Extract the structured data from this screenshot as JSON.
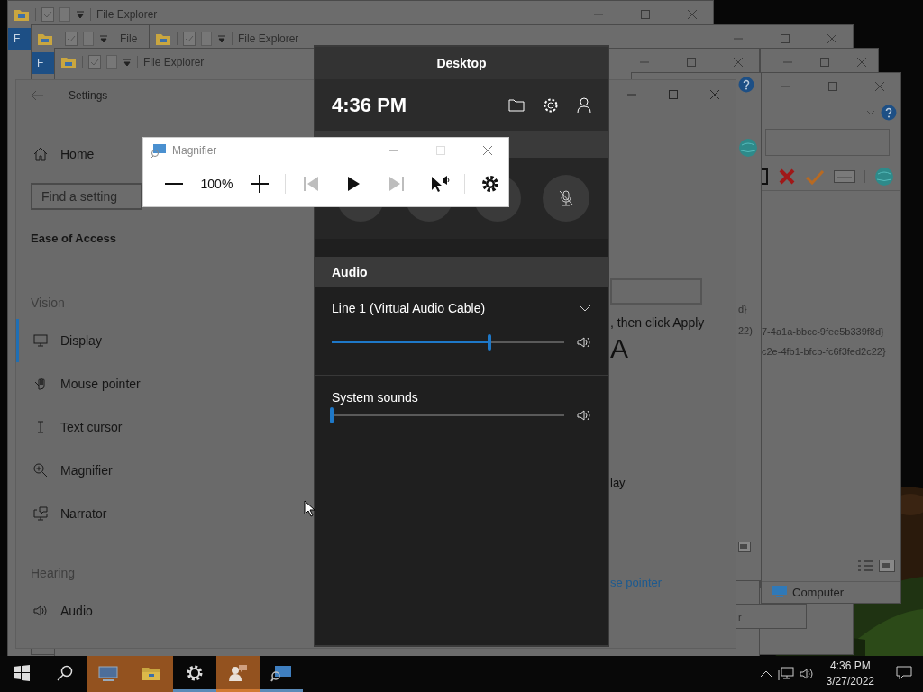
{
  "explorer_windows": [
    {
      "title": "File Explorer",
      "ribbon_tab": "F"
    },
    {
      "title": "File",
      "ribbon_tab": "F"
    },
    {
      "title": "File Explorer"
    },
    {
      "title": "File Explorer"
    }
  ],
  "dialogs": [
    {
      "lines": [
        "d}",
        "22)"
      ]
    },
    {
      "lines": [
        "7-4a1a-bbcc-9fee5b339f8d}",
        "c2e-4fb1-bfcb-fc6f3fed2c22}"
      ],
      "status": "Computer"
    },
    {
      "lines": [
        "r"
      ]
    }
  ],
  "settings": {
    "title": "Settings",
    "home": "Home",
    "search": {
      "placeholder": "Find a setting"
    },
    "heading": "Ease of Access",
    "groups": [
      {
        "label": "Vision",
        "items": [
          {
            "kind": "display",
            "label": "Display",
            "selected": true
          },
          {
            "kind": "mouse",
            "label": "Mouse pointer",
            "selected": false
          },
          {
            "kind": "text-cursor",
            "label": "Text cursor",
            "selected": false
          },
          {
            "kind": "magnifier",
            "label": "Magnifier",
            "selected": false
          },
          {
            "kind": "narrator",
            "label": "Narrator",
            "selected": false
          }
        ]
      },
      {
        "label": "Hearing",
        "items": [
          {
            "kind": "audio",
            "label": "Audio",
            "selected": false
          }
        ]
      }
    ],
    "content": {
      "instruction": ", then click Apply",
      "sample": "A",
      "line_3": "lay",
      "link": "se pointer"
    }
  },
  "game_bar": {
    "title": "Desktop",
    "time": "4:36 PM",
    "audio": {
      "heading": "Audio",
      "devices": [
        {
          "name": "Line 1 (Virtual Audio Cable)",
          "level": 0.68,
          "expandable": true
        },
        {
          "name": "System sounds",
          "level": 0,
          "expandable": false
        }
      ]
    }
  },
  "magnifier": {
    "title": "Magnifier",
    "zoom": "100%",
    "controls": [
      {
        "kind": "previous",
        "disabled": true
      },
      {
        "kind": "play",
        "disabled": false
      },
      {
        "kind": "next",
        "disabled": true
      }
    ]
  },
  "taskbar": {
    "apps": [
      {
        "kind": "remote-desktop",
        "flashing": true,
        "running": false
      },
      {
        "kind": "file-explorer",
        "flashing": true,
        "running": false
      },
      {
        "kind": "settings",
        "flashing": false,
        "running": true
      },
      {
        "kind": "people",
        "flashing": true,
        "running": true
      },
      {
        "kind": "magnifier",
        "flashing": false,
        "running": true
      }
    ],
    "time": "4:36 PM",
    "date": "3/27/2022"
  }
}
